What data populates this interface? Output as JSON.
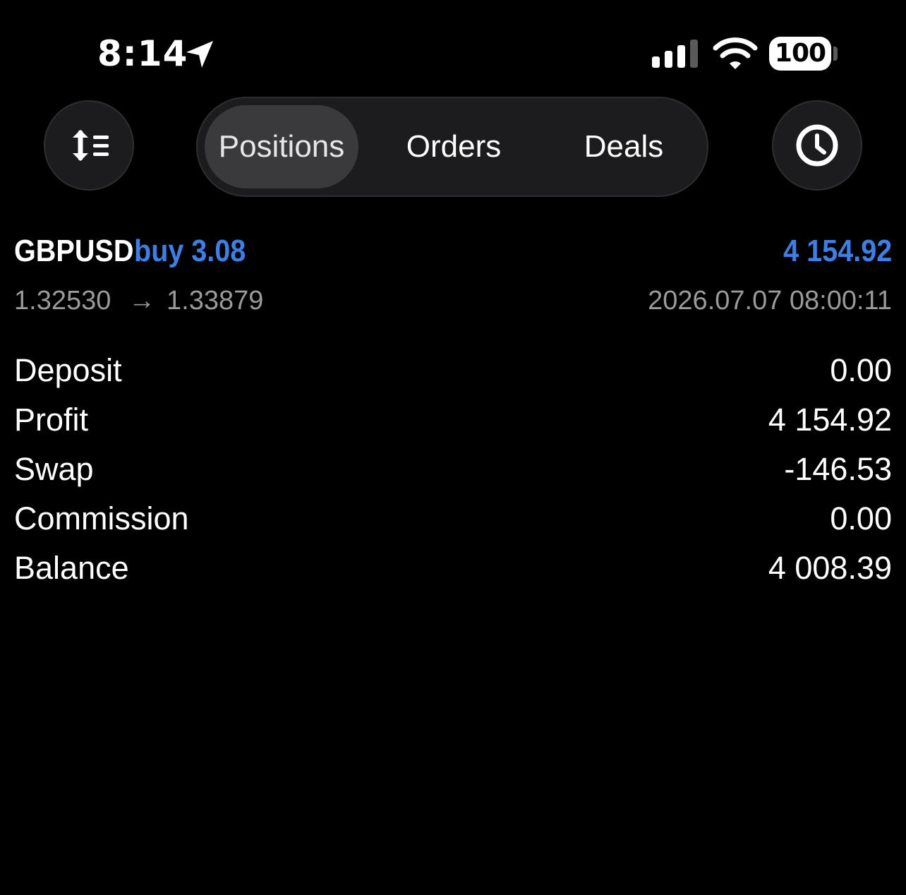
{
  "status_bar": {
    "time": "8:14",
    "battery": "100",
    "icons": [
      "location-arrow-icon",
      "cellular-signal-icon",
      "wifi-icon",
      "battery-icon"
    ]
  },
  "toolbar": {
    "sort_icon": "sort-lines-icon",
    "history_icon": "clock-icon",
    "tabs": [
      {
        "label": "Positions",
        "selected": true
      },
      {
        "label": "Orders",
        "selected": false
      },
      {
        "label": "Deals",
        "selected": false
      }
    ]
  },
  "position": {
    "symbol": "GBPUSD",
    "side": "buy",
    "volume": "3.08",
    "profit": "4 154.92",
    "open_price": "1.32530",
    "arrow": "→",
    "current_price": "1.33879",
    "time": "2026.07.07 08:00:11"
  },
  "summary": [
    {
      "label": "Deposit",
      "value": "0.00"
    },
    {
      "label": "Profit",
      "value": "4 154.92"
    },
    {
      "label": "Swap",
      "value": "-146.53"
    },
    {
      "label": "Commission",
      "value": "0.00"
    },
    {
      "label": "Balance",
      "value": "4 008.39"
    }
  ],
  "colors": {
    "background": "#000000",
    "accent_blue": "#3d7fe6",
    "secondary_text": "#9a9a9a",
    "control_bg": "#1c1c1e",
    "selected_pill": "#3a3a3c"
  }
}
